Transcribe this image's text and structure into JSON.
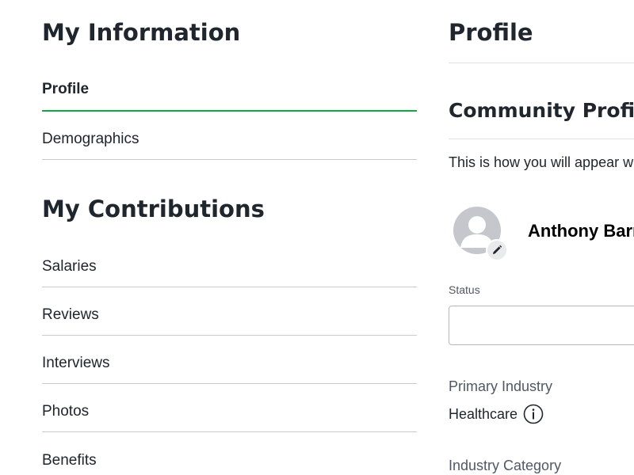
{
  "left": {
    "my_information": {
      "heading": "My Information",
      "items": [
        {
          "label": "Profile",
          "active": true
        },
        {
          "label": "Demographics",
          "active": false
        }
      ]
    },
    "my_contributions": {
      "heading": "My Contributions",
      "items": [
        {
          "label": "Salaries"
        },
        {
          "label": "Reviews"
        },
        {
          "label": "Interviews"
        },
        {
          "label": "Photos"
        },
        {
          "label": "Benefits"
        }
      ]
    }
  },
  "right": {
    "title": "Profile",
    "community_profile": {
      "title": "Community Profile",
      "description": "This is how you will appear when you contribute to the community",
      "user_name": "Anthony Barrett",
      "status": {
        "label": "Status",
        "value": "",
        "placeholder": ""
      },
      "primary_industry": {
        "label": "Primary Industry",
        "value": "Healthcare"
      },
      "industry_category": {
        "label": "Industry Category"
      }
    }
  },
  "icons": {
    "avatar": "user-avatar-icon",
    "edit": "pencil-icon",
    "info": "info-icon"
  },
  "colors": {
    "active_underline": "#0caa41",
    "divider": "#c9cbcd",
    "text": "#20262e",
    "muted_text": "#505863",
    "avatar_bg": "#c5c7cc"
  }
}
